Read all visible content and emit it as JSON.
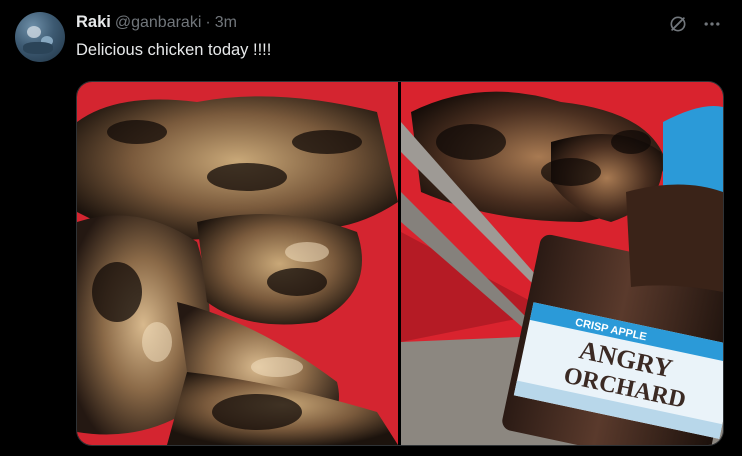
{
  "tweet": {
    "author_name": "Raki",
    "handle": "@ganbaraki",
    "separator": "·",
    "time": "3m",
    "text": "Delicious chicken today !!!!",
    "icons": {
      "grok": "grok-icon",
      "more": "more-options-icon"
    },
    "media": {
      "count": 2,
      "bottle_label_lines": [
        "CRISP APPLE",
        "ANGRY",
        "ORCHARD"
      ]
    }
  },
  "colors": {
    "background": "#000000",
    "primary_text": "#e7e9ea",
    "secondary_text": "#71767b",
    "tray_red": "#d9232e",
    "bottle_cap_blue": "#2b9ad8"
  }
}
